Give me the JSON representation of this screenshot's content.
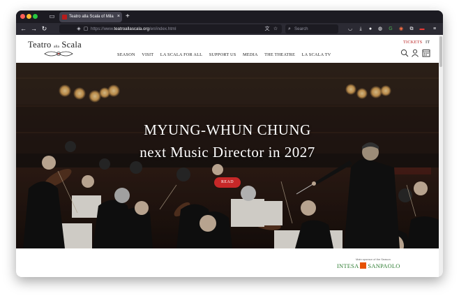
{
  "browser": {
    "tab_title": "Teatro alla Scala of Milan - Ope",
    "tab_close": "×",
    "new_tab": "+",
    "url_prefix": "https://www.",
    "url_domain": "teatroallascala.org",
    "url_path": "/en/index.html",
    "search_placeholder": "Search",
    "icons": [
      "back-icon",
      "forward-icon",
      "reload-icon",
      "shield-icon",
      "lock-icon",
      "translate-icon",
      "bookmark-star-icon",
      "search-icon",
      "pocket-icon",
      "download-icon",
      "account-icon",
      "extensions-icon",
      "menu-icon"
    ]
  },
  "site": {
    "logo": {
      "word1": "Teatro",
      "word2": "alla",
      "word3": "Scala"
    },
    "menu": [
      {
        "label": "SEASON"
      },
      {
        "label": "VISIT"
      },
      {
        "label": "LA SCALA FOR ALL"
      },
      {
        "label": "SUPPORT US"
      },
      {
        "label": "MEDIA"
      },
      {
        "label": "THE THEATRE"
      },
      {
        "label": "LA SCALA TV"
      }
    ],
    "tickets_label": "TICKETS",
    "language_label": "IT",
    "accent_color": "#b71c1c"
  },
  "hero": {
    "title_line1": "MYUNG-WHUN CHUNG",
    "title_line2": "next Music Director in 2027",
    "cta_label": "READ"
  },
  "footer": {
    "sponsor_label": "Main sponsor of the Season",
    "sponsor_name_left": "INTESA",
    "sponsor_name_right": "SANPAOLO"
  }
}
